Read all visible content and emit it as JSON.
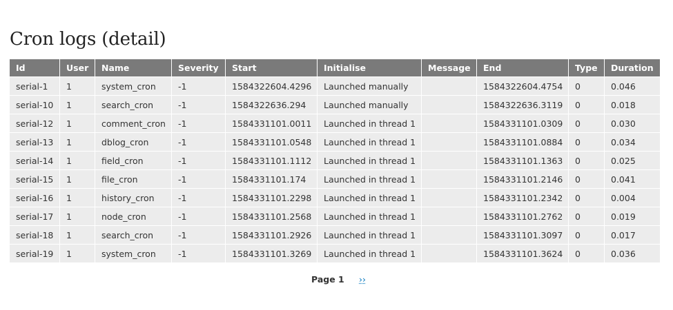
{
  "page": {
    "title": "Cron logs (detail)"
  },
  "table": {
    "columns": [
      "Id",
      "User",
      "Name",
      "Severity",
      "Start",
      "Initialise",
      "Message",
      "End",
      "Type",
      "Duration"
    ],
    "rows": [
      [
        "serial-1",
        "1",
        "system_cron",
        "-1",
        "1584322604.4296",
        "Launched manually",
        "",
        "1584322604.4754",
        "0",
        "0.046"
      ],
      [
        "serial-10",
        "1",
        "search_cron",
        "-1",
        "1584322636.294",
        "Launched manually",
        "",
        "1584322636.3119",
        "0",
        "0.018"
      ],
      [
        "serial-12",
        "1",
        "comment_cron",
        "-1",
        "1584331101.0011",
        "Launched in thread 1",
        "",
        "1584331101.0309",
        "0",
        "0.030"
      ],
      [
        "serial-13",
        "1",
        "dblog_cron",
        "-1",
        "1584331101.0548",
        "Launched in thread 1",
        "",
        "1584331101.0884",
        "0",
        "0.034"
      ],
      [
        "serial-14",
        "1",
        "field_cron",
        "-1",
        "1584331101.1112",
        "Launched in thread 1",
        "",
        "1584331101.1363",
        "0",
        "0.025"
      ],
      [
        "serial-15",
        "1",
        "file_cron",
        "-1",
        "1584331101.174",
        "Launched in thread 1",
        "",
        "1584331101.2146",
        "0",
        "0.041"
      ],
      [
        "serial-16",
        "1",
        "history_cron",
        "-1",
        "1584331101.2298",
        "Launched in thread 1",
        "",
        "1584331101.2342",
        "0",
        "0.004"
      ],
      [
        "serial-17",
        "1",
        "node_cron",
        "-1",
        "1584331101.2568",
        "Launched in thread 1",
        "",
        "1584331101.2762",
        "0",
        "0.019"
      ],
      [
        "serial-18",
        "1",
        "search_cron",
        "-1",
        "1584331101.2926",
        "Launched in thread 1",
        "",
        "1584331101.3097",
        "0",
        "0.017"
      ],
      [
        "serial-19",
        "1",
        "system_cron",
        "-1",
        "1584331101.3269",
        "Launched in thread 1",
        "",
        "1584331101.3624",
        "0",
        "0.036"
      ]
    ]
  },
  "pager": {
    "current": "Page 1",
    "next": "››"
  }
}
